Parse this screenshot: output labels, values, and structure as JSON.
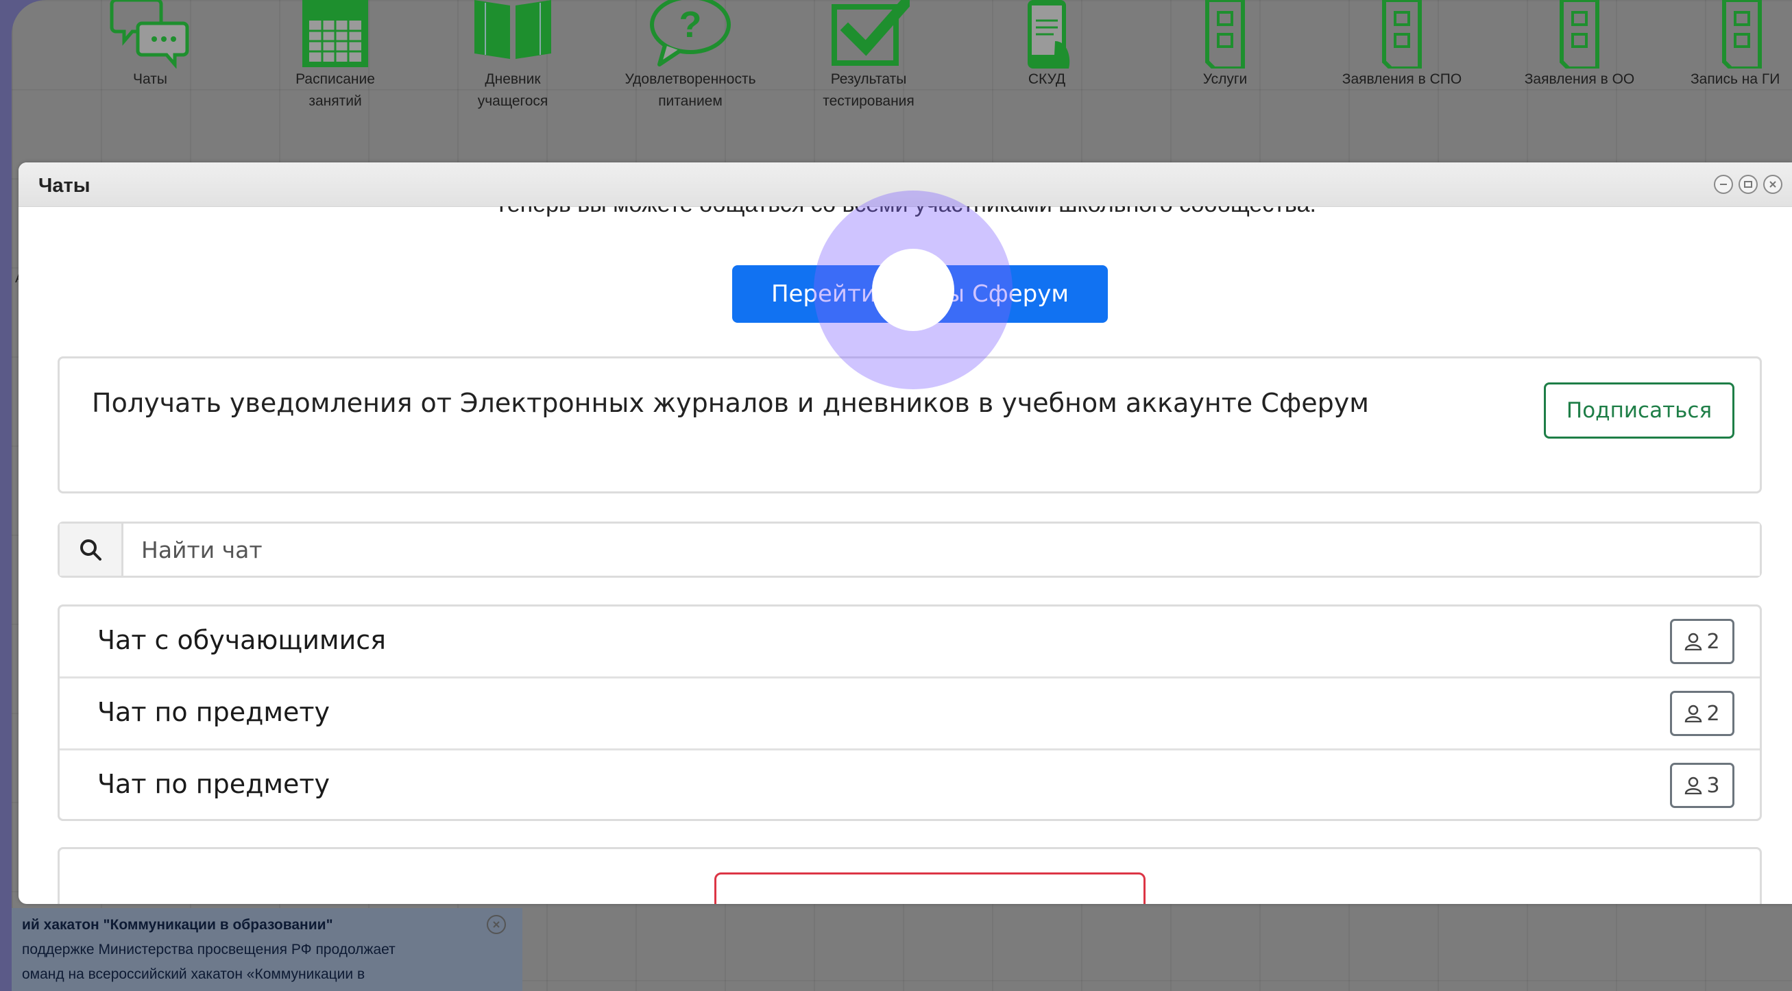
{
  "top_bar": {
    "apps": [
      {
        "icon": "chat-bubbles-icon",
        "label": "Чаты",
        "label2": ""
      },
      {
        "icon": "calendar-icon",
        "label": "Расписание",
        "label2": "занятий"
      },
      {
        "icon": "open-book-icon",
        "label": "Дневник",
        "label2": "учащегося"
      },
      {
        "icon": "question-bubble-icon",
        "label": "Удовлетворенность",
        "label2": "питанием"
      },
      {
        "icon": "checkbox-icon",
        "label": "Результаты",
        "label2": "тестирования"
      },
      {
        "icon": "phone-icon",
        "label": "СКУД",
        "label2": ""
      },
      {
        "icon": "document-icon",
        "label": "Услуги",
        "label2": ""
      },
      {
        "icon": "document-icon",
        "label": "Заявления в СПО",
        "label2": ""
      },
      {
        "icon": "document-icon",
        "label": "Заявления в ОО",
        "label2": ""
      },
      {
        "icon": "document-icon",
        "label": "Запись на ГИ",
        "label2": ""
      }
    ],
    "icon_color": "#1e8f2e"
  },
  "modal": {
    "title": "Чаты",
    "cut_off_text": "Теперь вы можете общаться со всеми участниками школьного сообщества.",
    "sferum_button": "Перейти в чаты Сферум",
    "notify_text": "Получать уведомления от Электронных журналов и дневников в учебном аккаунте Сферум",
    "subscribe_button": "Подписаться",
    "search_placeholder": "Найти чат",
    "chats": [
      {
        "name": "Чат с обучающимися",
        "members": "2"
      },
      {
        "name": "Чат по предмету",
        "members": "2"
      },
      {
        "name": "Чат по предмету",
        "members": "3"
      }
    ]
  },
  "news": {
    "title": "ий хакатон \"Коммуникации в образовании\"",
    "line1": "поддержке Министерства просвещения РФ продолжает",
    "line2": "оманд на всероссийский хакатон «Коммуникации в"
  },
  "edge_char": "А",
  "colors": {
    "primary": "#1172f2",
    "success": "#1e7e47",
    "danger": "#dc3545",
    "icon_green": "#1e8f2e"
  }
}
